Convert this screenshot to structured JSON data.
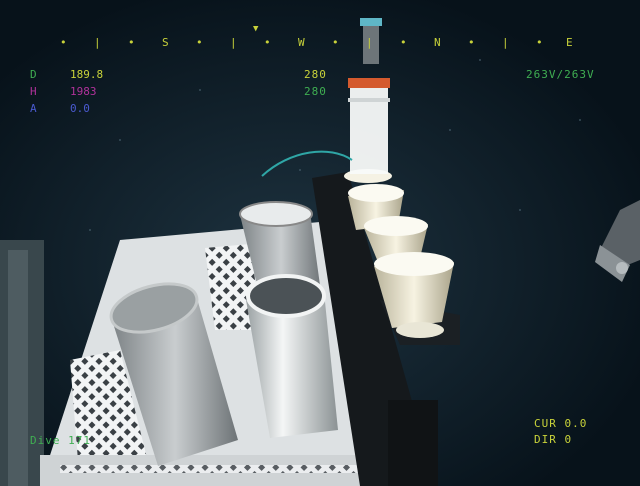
{
  "compass": {
    "marks": [
      "•",
      "|",
      "•",
      "S",
      "•",
      "|",
      "•",
      "W",
      "•",
      "|",
      "•",
      "N",
      "•",
      "|",
      "•",
      "E"
    ],
    "pointer": "▼"
  },
  "telemetry": {
    "d": {
      "label": "D",
      "value": "189.8"
    },
    "h": {
      "label": "H",
      "value": "1983"
    },
    "a": {
      "label": "A",
      "value": "0.0"
    }
  },
  "heading": {
    "top": "280",
    "bottom": "280"
  },
  "voltage": "263V/263V",
  "overlay_label": "Dive 171",
  "current": {
    "label": "CUR",
    "value": "0.0"
  },
  "direction": {
    "label": "DIR",
    "value": "0"
  },
  "colors": {
    "hud_yellow": "#c8d23a",
    "hud_green": "#3fae52",
    "hud_magenta": "#b0329a",
    "hud_blue": "#4a5ad0",
    "sea": "#0b1822"
  }
}
